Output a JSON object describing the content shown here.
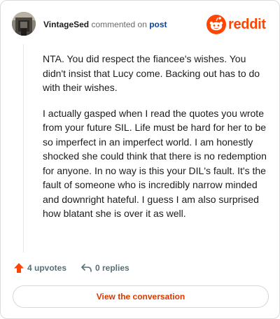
{
  "header": {
    "username": "VintageSed",
    "verb": "commented on",
    "post_link": "post",
    "brand": "reddit",
    "brand_color": "#ff4500",
    "avatar_icon": "user-avatar"
  },
  "comment": {
    "paragraphs": [
      "NTA. You did respect the fiancee's wishes. You didn't insist that Lucy come. Backing out has to do with their wishes.",
      "I actually gasped when I read the quotes you wrote from your future SIL. Life must be hard for her to be so imperfect in an imperfect world. I am honestly shocked she could think that there is no redemption for anyone. In no way is this your DIL's fault. It's the fault of someone who is incredibly narrow minded and downright hateful. I guess I am also surprised how blatant she is over it as well."
    ]
  },
  "actions": {
    "upvotes": "4 upvotes",
    "replies": "0 replies",
    "upvote_icon": "upvote-arrow-icon",
    "reply_icon": "reply-arrow-icon",
    "upvote_color": "#ff4500"
  },
  "cta": {
    "label": "View the conversation",
    "color": "#d93900"
  }
}
